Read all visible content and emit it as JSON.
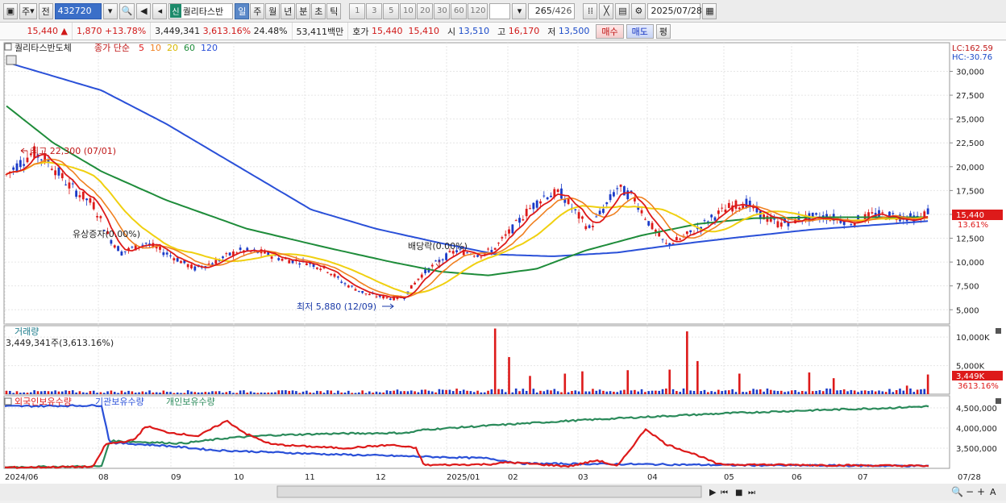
{
  "toolbar": {
    "period_word": "주",
    "view_word": "전",
    "code": "432720",
    "new_badge": "신",
    "stock_name": "퀄리타스반",
    "periods": [
      "일",
      "주",
      "월",
      "년",
      "분",
      "초",
      "틱"
    ],
    "active_period": "일",
    "intervals": [
      "1",
      "3",
      "5",
      "10",
      "20",
      "30",
      "60",
      "120"
    ],
    "count": "265",
    "total": "/426",
    "date": "2025/07/28"
  },
  "quote": {
    "price": "15,440",
    "change": "1,870",
    "change_pct": "+13.78%",
    "volume": "3,449,341",
    "volume_pct": "3,613.16%",
    "turnover": "24.48%",
    "amount": "53,411백만",
    "hoga_label": "호가",
    "ask": "15,440",
    "bid": "15,410",
    "open_label": "시",
    "open": "13,510",
    "high_label": "고",
    "high": "16,170",
    "low_label": "저",
    "low": "13,500",
    "buy_label": "매수",
    "sell_label": "매도",
    "eval_label": "평"
  },
  "price_panel": {
    "name": "퀄리타스반도체",
    "ma_title": "종가 단순",
    "ma_periods": [
      "5",
      "10",
      "20",
      "60",
      "120"
    ],
    "ma_colors": [
      "#dd1a1a",
      "#f08020",
      "#f0d010",
      "#1e8c3a",
      "#2a50d8"
    ],
    "lc": "LC:162.59",
    "hc": "HC:-30.76",
    "y_ticks": [
      "30,000",
      "27,500",
      "25,000",
      "22,500",
      "20,000",
      "17,500",
      "15,000",
      "12,500",
      "10,000",
      "7,500",
      "5,000"
    ],
    "last_price_tag": "15,440",
    "last_pct_tag": "13.61%",
    "annotations": {
      "high": "최고 22,300 (07/01)",
      "rights": "유상증자(0.00%)",
      "dividend": "배당락(0.00%)",
      "low": "최저 5,880 (12/09)"
    }
  },
  "volume_panel": {
    "title": "거래량",
    "summary": "3,449,341주(3,613.16%)",
    "y_ticks": [
      "10,000K",
      "5,000K"
    ],
    "last_tag": "3,449K",
    "last_pct": "3613.16%"
  },
  "holdings_panel": {
    "legend": [
      "외국인보유수량",
      "기관보유수량",
      "개인보유수량"
    ],
    "colors": [
      "#dd1a1a",
      "#2a50d8",
      "#2a8a5a"
    ],
    "y_ticks": [
      "4,500,000",
      "4,000,000",
      "3,500,000"
    ]
  },
  "x_axis": {
    "labels": [
      "2024/06",
      "08",
      "09",
      "10",
      "11",
      "12",
      "2025/01",
      "02",
      "03",
      "04",
      "05",
      "06",
      "07"
    ],
    "end_label": "07/28"
  },
  "chart_data": {
    "type": "line",
    "title": "퀄리타스반도체 일봉",
    "series": [
      {
        "name": "5",
        "values": [
          19500,
          20000,
          21000,
          21500,
          20500,
          20000,
          18500,
          17500,
          16500,
          15000,
          14000,
          12000,
          11500,
          12000,
          11000,
          10000,
          9500,
          9000,
          9500,
          10500,
          11000,
          11500,
          12000,
          11500,
          11000,
          10500,
          10200,
          10000,
          9500,
          9000,
          8500,
          7500,
          6800,
          6300,
          6100,
          6000,
          6300,
          7000,
          8500,
          9800,
          10500,
          10000,
          9800,
          10500,
          11500,
          13000,
          14000,
          15000,
          16000,
          17000,
          15000,
          13500,
          13000,
          15500,
          17000,
          17500,
          16000,
          14500,
          12500,
          11500,
          12500,
          13500,
          14500,
          15500,
          16000,
          15500,
          15000,
          14500,
          14000,
          14500,
          15000,
          14500,
          14800,
          15000,
          14600,
          14800,
          15000,
          14400,
          15400
        ]
      }
    ],
    "ylim": [
      5000,
      32000
    ]
  }
}
